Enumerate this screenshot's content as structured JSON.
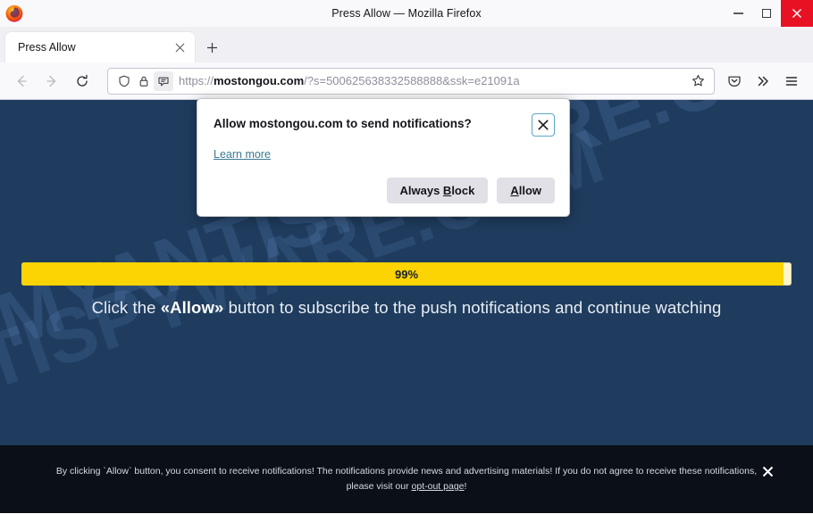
{
  "window": {
    "title": "Press Allow — Mozilla Firefox",
    "controls": {
      "minimize": "—",
      "maximize": "□",
      "close": "✕"
    }
  },
  "tabs": {
    "items": [
      {
        "title": "Press Allow",
        "close_label": "✕"
      }
    ],
    "new_tab_label": "+"
  },
  "toolbar": {
    "back_label": "←",
    "forward_label": "→",
    "reload_label": "⟳",
    "pocket_label": "Save to Pocket",
    "overflow_label": "»",
    "menu_label": "≡",
    "bookmark_label": "☆"
  },
  "urlbar": {
    "scheme": "https://",
    "host": "mostongou.com",
    "path": "/?s=500625638332588888&ssk=e21091a",
    "full_url": "https://mostongou.com/?s=500625638332588888&ssk=e21091a",
    "shield_icon": "shield-icon",
    "lock_icon": "lock-icon",
    "permission_icon": "notification-permission-icon"
  },
  "doorhanger": {
    "title": "Allow mostongou.com to send notifications?",
    "learn_more": "Learn more",
    "close_label": "✕",
    "buttons": {
      "always_block": {
        "pre": "Always ",
        "accel": "B",
        "post": "lock"
      },
      "allow": {
        "accel": "A",
        "post": "llow"
      }
    }
  },
  "page": {
    "watermark": "MYANTISPYWARE.COM",
    "watermark_2": "MYANTISPYWARE.COM",
    "progress": {
      "percent_label": "99%",
      "percent_value": 99
    },
    "instruction": {
      "before": "Click the ",
      "emphasis": "«Allow»",
      "after": " button to subscribe to the push notifications and continue watching"
    },
    "colors": {
      "background": "#1f3c5e",
      "progress_fill": "#fcd303",
      "progress_track": "#fdf6c9",
      "consent_bar": "#0b0f18"
    }
  },
  "consent": {
    "line1": "By clicking `Allow` button, you consent to receive notifications! The notifications provide news and advertising materials! If you do not agree to receive",
    "line2_before": "these notifications, please visit our ",
    "link": "opt-out page",
    "line2_after": "!",
    "close_label": "✕"
  }
}
